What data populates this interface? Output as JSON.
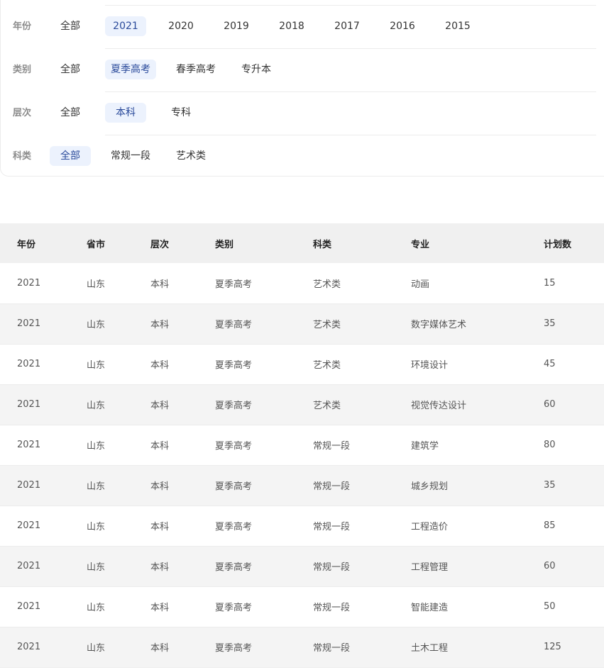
{
  "filters": {
    "year": {
      "label": "年份",
      "options": [
        "全部",
        "2021",
        "2020",
        "2019",
        "2018",
        "2017",
        "2016",
        "2015"
      ],
      "selected": "2021"
    },
    "category": {
      "label": "类别",
      "options": [
        "全部",
        "夏季高考",
        "春季高考",
        "专升本"
      ],
      "selected": "夏季高考"
    },
    "level": {
      "label": "层次",
      "options": [
        "全部",
        "本科",
        "专科"
      ],
      "selected": "本科"
    },
    "subject": {
      "label": "科类",
      "options": [
        "全部",
        "常规一段",
        "艺术类"
      ],
      "selected": "全部"
    }
  },
  "table": {
    "headers": [
      "年份",
      "省市",
      "层次",
      "类别",
      "科类",
      "专业",
      "计划数"
    ],
    "rows": [
      [
        "2021",
        "山东",
        "本科",
        "夏季高考",
        "艺术类",
        "动画",
        "15"
      ],
      [
        "2021",
        "山东",
        "本科",
        "夏季高考",
        "艺术类",
        "数字媒体艺术",
        "35"
      ],
      [
        "2021",
        "山东",
        "本科",
        "夏季高考",
        "艺术类",
        "环境设计",
        "45"
      ],
      [
        "2021",
        "山东",
        "本科",
        "夏季高考",
        "艺术类",
        "视觉传达设计",
        "60"
      ],
      [
        "2021",
        "山东",
        "本科",
        "夏季高考",
        "常规一段",
        "建筑学",
        "80"
      ],
      [
        "2021",
        "山东",
        "本科",
        "夏季高考",
        "常规一段",
        "城乡规划",
        "35"
      ],
      [
        "2021",
        "山东",
        "本科",
        "夏季高考",
        "常规一段",
        "工程造价",
        "85"
      ],
      [
        "2021",
        "山东",
        "本科",
        "夏季高考",
        "常规一段",
        "工程管理",
        "60"
      ],
      [
        "2021",
        "山东",
        "本科",
        "夏季高考",
        "常规一段",
        "智能建造",
        "50"
      ],
      [
        "2021",
        "山东",
        "本科",
        "夏季高考",
        "常规一段",
        "土木工程",
        "125"
      ]
    ]
  },
  "colors": {
    "accent_bg": "#ecf2fd",
    "accent_text": "#2a4a9a",
    "header_bg": "#f0f0f0",
    "stripe_bg": "#f4f4f4"
  }
}
